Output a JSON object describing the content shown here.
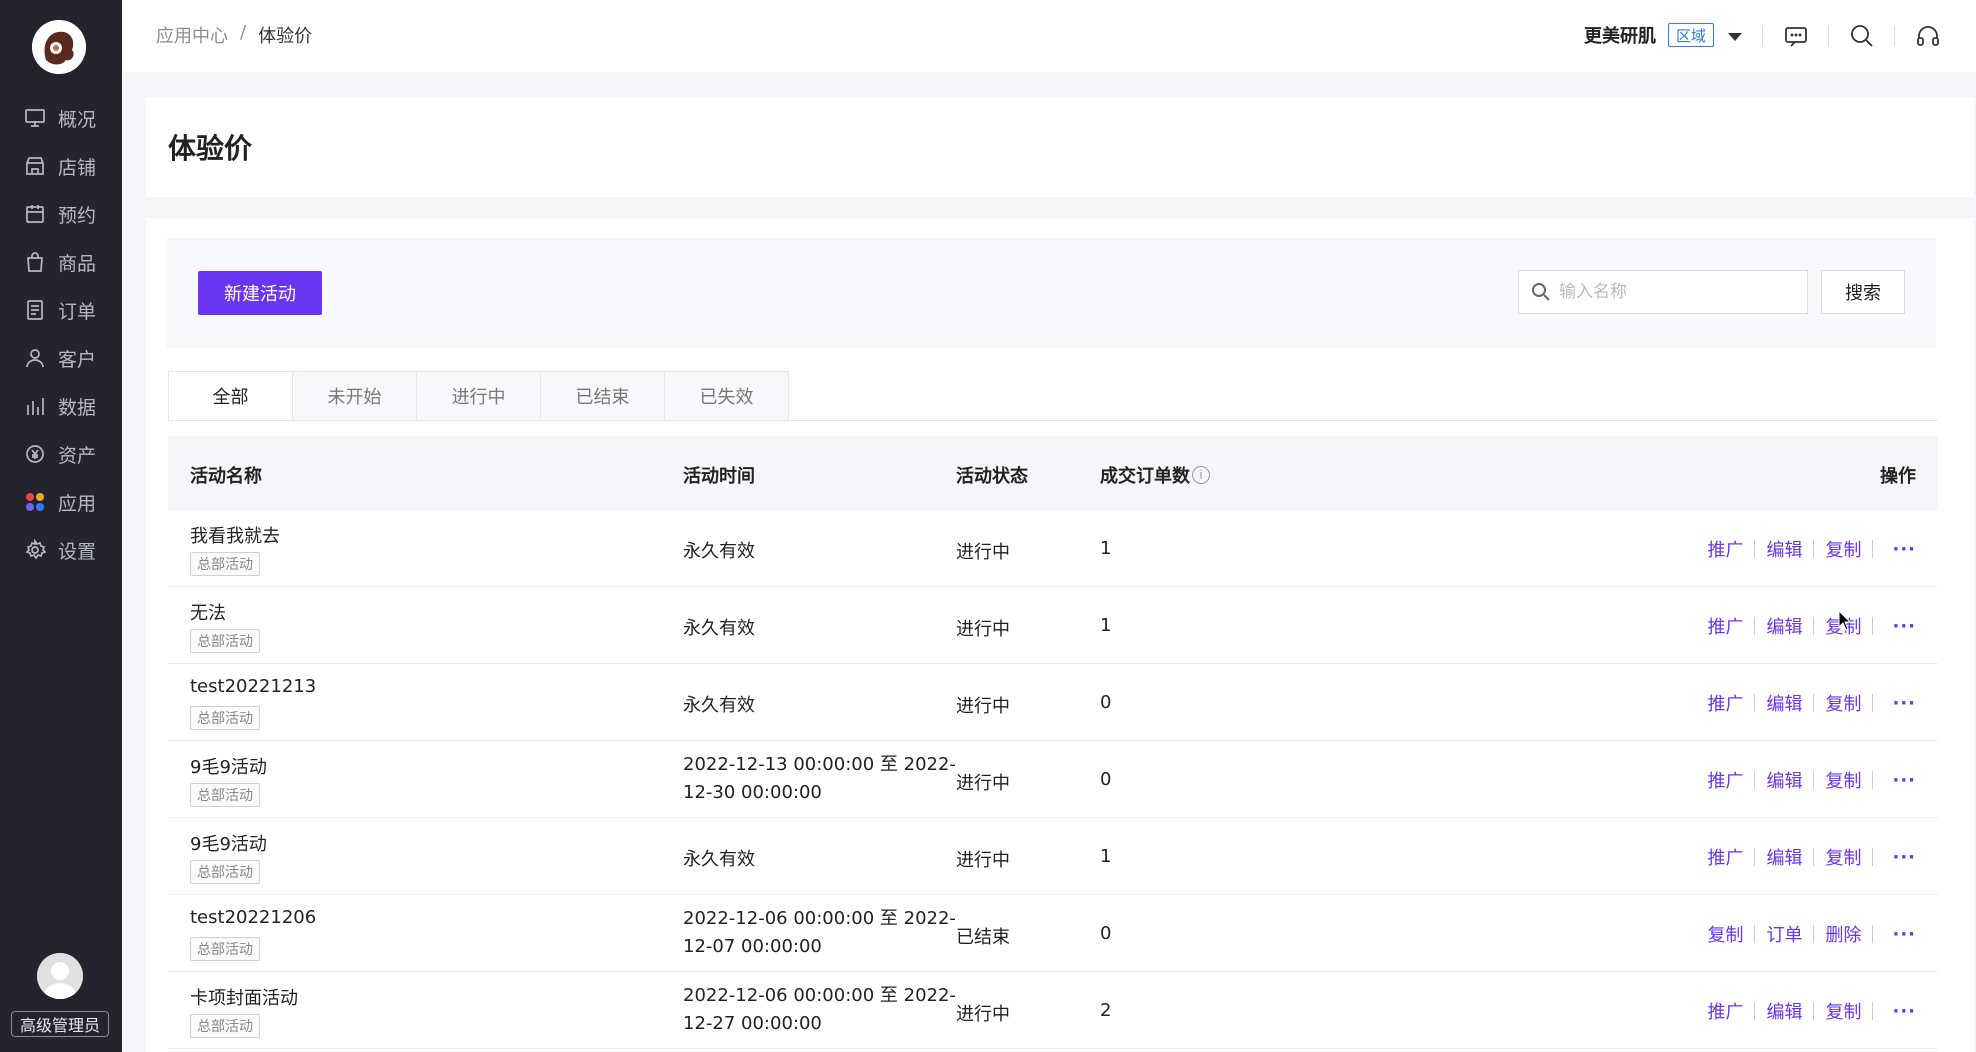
{
  "sidebar": {
    "items": [
      {
        "label": "概况",
        "icon": "monitor-icon"
      },
      {
        "label": "店铺",
        "icon": "store-icon"
      },
      {
        "label": "预约",
        "icon": "calendar-icon"
      },
      {
        "label": "商品",
        "icon": "bag-icon"
      },
      {
        "label": "订单",
        "icon": "document-icon"
      },
      {
        "label": "客户",
        "icon": "user-icon"
      },
      {
        "label": "数据",
        "icon": "bar-chart-icon"
      },
      {
        "label": "资产",
        "icon": "yen-icon"
      },
      {
        "label": "应用",
        "icon": "apps-icon"
      },
      {
        "label": "设置",
        "icon": "gear-icon"
      }
    ],
    "role": "高级管理员"
  },
  "header": {
    "breadcrumb": {
      "parent": "应用中心",
      "separator": "/",
      "current": "体验价"
    },
    "store_name": "更美研肌",
    "region_badge": "区域"
  },
  "page": {
    "title": "体验价"
  },
  "toolbar": {
    "new_button": "新建活动",
    "search_placeholder": "输入名称",
    "search_button": "搜索"
  },
  "tabs": [
    "全部",
    "未开始",
    "进行中",
    "已结束",
    "已失效"
  ],
  "table": {
    "headers": {
      "name": "活动名称",
      "time": "活动时间",
      "status": "活动状态",
      "orders": "成交订单数",
      "actions": "操作"
    },
    "rows": [
      {
        "name": "我看我就去",
        "tag": "总部活动",
        "time": "永久有效",
        "status": "进行中",
        "orders": "1",
        "actions": [
          "推广",
          "编辑",
          "复制"
        ]
      },
      {
        "name": "无法",
        "tag": "总部活动",
        "time": "永久有效",
        "status": "进行中",
        "orders": "1",
        "actions": [
          "推广",
          "编辑",
          "复制"
        ]
      },
      {
        "name": "test20221213",
        "tag": "总部活动",
        "time": "永久有效",
        "status": "进行中",
        "orders": "0",
        "actions": [
          "推广",
          "编辑",
          "复制"
        ]
      },
      {
        "name": "9毛9活动",
        "tag": "总部活动",
        "time": "2022-12-13 00:00:00 至 2022-12-30 00:00:00",
        "status": "进行中",
        "orders": "0",
        "actions": [
          "推广",
          "编辑",
          "复制"
        ]
      },
      {
        "name": "9毛9活动",
        "tag": "总部活动",
        "time": "永久有效",
        "status": "进行中",
        "orders": "1",
        "actions": [
          "推广",
          "编辑",
          "复制"
        ]
      },
      {
        "name": "test20221206",
        "tag": "总部活动",
        "time": "2022-12-06 00:00:00 至 2022-12-07 00:00:00",
        "status": "已结束",
        "orders": "0",
        "actions": [
          "复制",
          "订单",
          "删除"
        ]
      },
      {
        "name": "卡项封面活动",
        "tag": "总部活动",
        "time": "2022-12-06 00:00:00 至 2022-12-27 00:00:00",
        "status": "进行中",
        "orders": "2",
        "actions": [
          "推广",
          "编辑",
          "复制"
        ]
      }
    ]
  },
  "colors": {
    "accent": "#6a35f0",
    "sidebar_bg": "#23242e",
    "region": "#2f7bf5"
  }
}
